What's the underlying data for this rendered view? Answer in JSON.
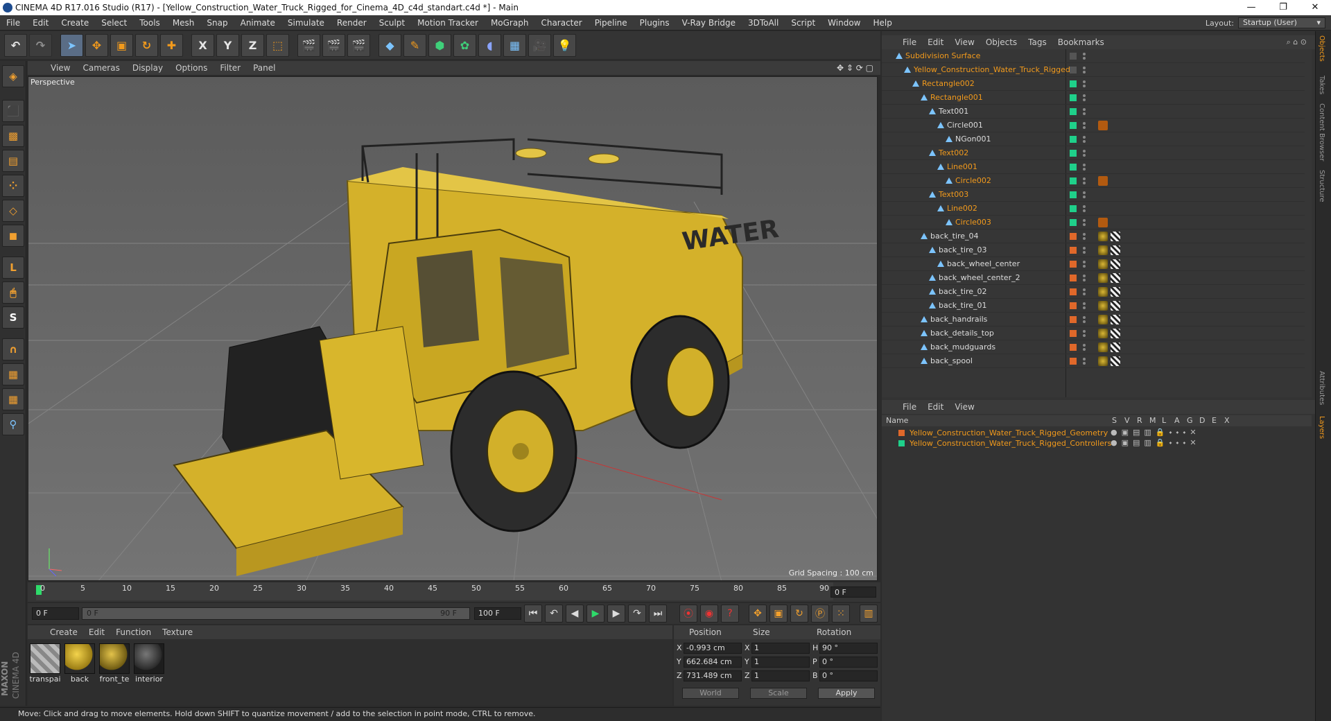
{
  "window": {
    "title": "CINEMA 4D R17.016 Studio (R17) - [Yellow_Construction_Water_Truck_Rigged_for_Cinema_4D_c4d_standart.c4d *] - Main",
    "minimize": "—",
    "maximize": "❐",
    "close": "✕"
  },
  "menu": [
    "File",
    "Edit",
    "Create",
    "Select",
    "Tools",
    "Mesh",
    "Snap",
    "Animate",
    "Simulate",
    "Render",
    "Sculpt",
    "Motion Tracker",
    "MoGraph",
    "Character",
    "Pipeline",
    "Plugins",
    "V-Ray Bridge",
    "3DToAll",
    "Script",
    "Window",
    "Help"
  ],
  "layout": {
    "label": "Layout:",
    "value": "Startup (User)"
  },
  "toolbar": {
    "undo": "↶",
    "redo": "↷",
    "x": "X",
    "y": "Y",
    "z": "Z"
  },
  "viewport": {
    "menu": [
      "View",
      "Cameras",
      "Display",
      "Options",
      "Filter",
      "Panel"
    ],
    "label": "Perspective",
    "grid_spacing": "Grid Spacing : 100 cm",
    "tank_text": "WATER"
  },
  "timeline": {
    "ticks": [
      "0",
      "5",
      "10",
      "15",
      "20",
      "25",
      "30",
      "35",
      "40",
      "45",
      "50",
      "55",
      "60",
      "65",
      "70",
      "75",
      "80",
      "85",
      "90"
    ],
    "end_frame": "0 F",
    "current": "0 F",
    "range_start": "0 F",
    "range_end": "90 F",
    "max": "100 F"
  },
  "materials": {
    "menu": [
      "Create",
      "Edit",
      "Function",
      "Texture"
    ],
    "items": [
      {
        "label": "transpai"
      },
      {
        "label": "back"
      },
      {
        "label": "front_te"
      },
      {
        "label": "interior"
      }
    ]
  },
  "coordinates": {
    "headers": {
      "position": "Position",
      "size": "Size",
      "rotation": "Rotation"
    },
    "rows": [
      {
        "axis": "X",
        "pos": "-0.993 cm",
        "size_axis": "X",
        "size": "1",
        "rot_axis": "H",
        "rot": "90 °"
      },
      {
        "axis": "Y",
        "pos": "662.684 cm",
        "size_axis": "Y",
        "size": "1",
        "rot_axis": "P",
        "rot": "0 °"
      },
      {
        "axis": "Z",
        "pos": "731.489 cm",
        "size_axis": "Z",
        "size": "1",
        "rot_axis": "B",
        "rot": "0 °"
      }
    ],
    "world": "World",
    "scale": "Scale",
    "apply": "Apply"
  },
  "status": "Move: Click and drag to move elements. Hold down SHIFT to quantize movement / add to the selection in point mode, CTRL to remove.",
  "logo": {
    "maxon": "MAXON",
    "c4d": "CINEMA 4D"
  },
  "objects": {
    "menu": [
      "File",
      "Edit",
      "View",
      "Objects",
      "Tags",
      "Bookmarks"
    ],
    "rows": [
      {
        "name": "Subdivision Surface",
        "indent": 0,
        "orange": true
      },
      {
        "name": "Yellow_Construction_Water_Truck_Rigged",
        "indent": 1,
        "orange": true
      },
      {
        "name": "Rectangle002",
        "indent": 2,
        "orange": true
      },
      {
        "name": "Rectangle001",
        "indent": 3,
        "orange": true
      },
      {
        "name": "Text001",
        "indent": 4,
        "orange": false
      },
      {
        "name": "Circle001",
        "indent": 5,
        "orange": false
      },
      {
        "name": "NGon001",
        "indent": 6,
        "orange": false
      },
      {
        "name": "Text002",
        "indent": 4,
        "orange": true
      },
      {
        "name": "Line001",
        "indent": 5,
        "orange": true
      },
      {
        "name": "Circle002",
        "indent": 6,
        "orange": true
      },
      {
        "name": "Text003",
        "indent": 4,
        "orange": true
      },
      {
        "name": "Line002",
        "indent": 5,
        "orange": true
      },
      {
        "name": "Circle003",
        "indent": 6,
        "orange": true
      },
      {
        "name": "back_tire_04",
        "indent": 3,
        "orange": false
      },
      {
        "name": "back_tire_03",
        "indent": 4,
        "orange": false
      },
      {
        "name": "back_wheel_center",
        "indent": 5,
        "orange": false
      },
      {
        "name": "back_wheel_center_2",
        "indent": 4,
        "orange": false
      },
      {
        "name": "back_tire_02",
        "indent": 4,
        "orange": false
      },
      {
        "name": "back_tire_01",
        "indent": 4,
        "orange": false
      },
      {
        "name": "back_handrails",
        "indent": 3,
        "orange": false
      },
      {
        "name": "back_details_top",
        "indent": 3,
        "orange": false
      },
      {
        "name": "back_mudguards",
        "indent": 3,
        "orange": false
      },
      {
        "name": "back_spool",
        "indent": 3,
        "orange": false
      }
    ]
  },
  "layers": {
    "menu": [
      "File",
      "Edit",
      "View"
    ],
    "name_header": "Name",
    "flags": [
      "S",
      "V",
      "R",
      "M",
      "L",
      "A",
      "G",
      "D",
      "E",
      "X"
    ],
    "rows": [
      {
        "name": "Yellow_Construction_Water_Truck_Rigged_Geometry",
        "color": "#e0682a"
      },
      {
        "name": "Yellow_Construction_Water_Truck_Rigged_Controllers",
        "color": "#1fd08a"
      }
    ]
  },
  "sidetabs": [
    "Objects",
    "Takes",
    "Content Browser",
    "Structure",
    "Attributes",
    "Layers"
  ],
  "colors": {
    "accent": "#f29a1c",
    "object_layer_green": "#1fd08a",
    "object_layer_orange": "#e0682a",
    "viewport_bg": "#6a6a6a"
  }
}
